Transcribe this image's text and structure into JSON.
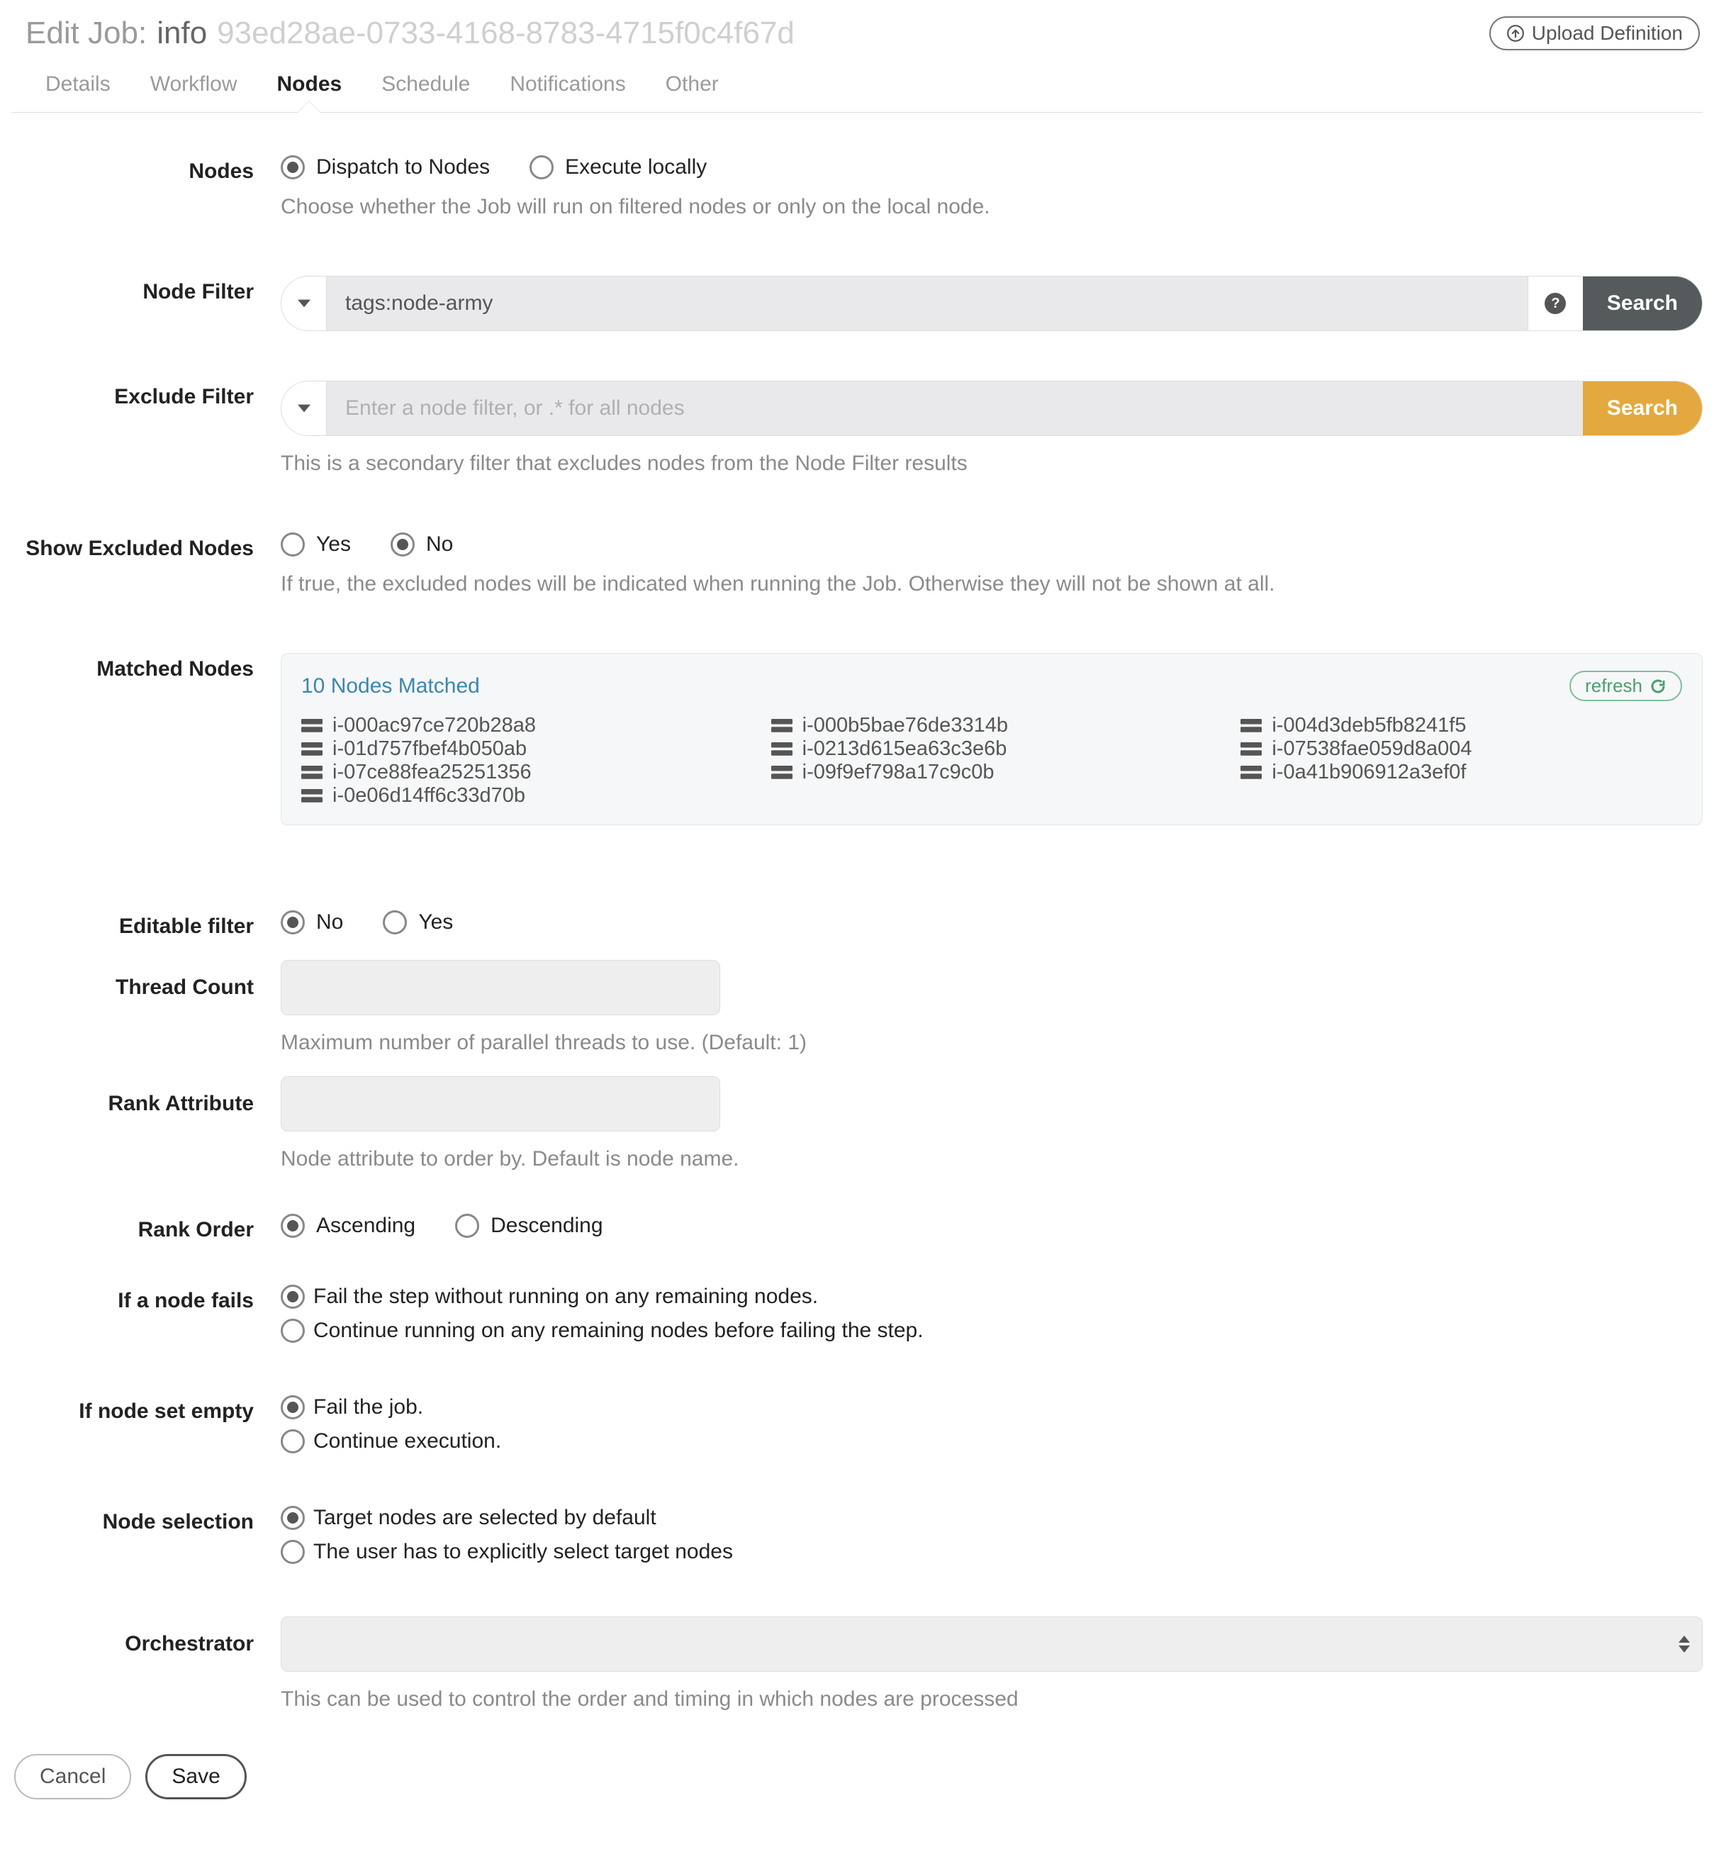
{
  "header": {
    "prefix": "Edit Job:",
    "jobname": "info",
    "uuid": "93ed28ae-0733-4168-8783-4715f0c4f67d",
    "upload_label": "Upload Definition"
  },
  "tabs": {
    "items": [
      "Details",
      "Workflow",
      "Nodes",
      "Schedule",
      "Notifications",
      "Other"
    ],
    "active_index": 2
  },
  "nodes": {
    "label": "Nodes",
    "dispatch": "Dispatch to Nodes",
    "local": "Execute locally",
    "help": "Choose whether the Job will run on filtered nodes or only on the local node."
  },
  "node_filter": {
    "label": "Node Filter",
    "value": "tags:node-army",
    "search": "Search"
  },
  "exclude_filter": {
    "label": "Exclude Filter",
    "placeholder": "Enter a node filter, or .* for all nodes",
    "search": "Search",
    "help": "This is a secondary filter that excludes nodes from the Node Filter results"
  },
  "show_excluded": {
    "label": "Show Excluded Nodes",
    "yes": "Yes",
    "no": "No",
    "help": "If true, the excluded nodes will be indicated when running the Job. Otherwise they will not be shown at all."
  },
  "matched": {
    "label": "Matched Nodes",
    "summary": "10 Nodes Matched",
    "refresh": "refresh",
    "nodes": [
      "i-000ac97ce720b28a8",
      "i-000b5bae76de3314b",
      "i-004d3deb5fb8241f5",
      "i-01d757fbef4b050ab",
      "i-0213d615ea63c3e6b",
      "i-07538fae059d8a004",
      "i-07ce88fea25251356",
      "i-09f9ef798a17c9c0b",
      "i-0a41b906912a3ef0f",
      "i-0e06d14ff6c33d70b"
    ]
  },
  "editable_filter": {
    "label": "Editable filter",
    "no": "No",
    "yes": "Yes"
  },
  "thread_count": {
    "label": "Thread Count",
    "value": "",
    "help": "Maximum number of parallel threads to use. (Default: 1)"
  },
  "rank_attribute": {
    "label": "Rank Attribute",
    "value": "",
    "help": "Node attribute to order by. Default is node name."
  },
  "rank_order": {
    "label": "Rank Order",
    "asc": "Ascending",
    "desc": "Descending"
  },
  "node_fails": {
    "label": "If a node fails",
    "opt1": "Fail the step without running on any remaining nodes.",
    "opt2": "Continue running on any remaining nodes before failing the step."
  },
  "node_empty": {
    "label": "If node set empty",
    "opt1": "Fail the job.",
    "opt2": "Continue execution."
  },
  "node_selection": {
    "label": "Node selection",
    "opt1": "Target nodes are selected by default",
    "opt2": "The user has to explicitly select target nodes"
  },
  "orchestrator": {
    "label": "Orchestrator",
    "value": "",
    "help": "This can be used to control the order and timing in which nodes are processed"
  },
  "footer": {
    "cancel": "Cancel",
    "save": "Save"
  }
}
